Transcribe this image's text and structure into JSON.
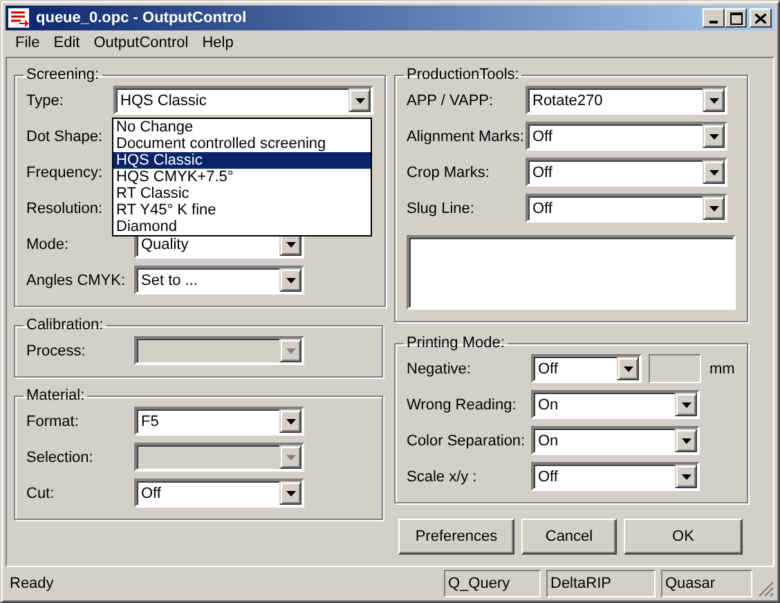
{
  "window": {
    "title": "queue_0.opc - OutputControl"
  },
  "menu": [
    "File",
    "Edit",
    "OutputControl",
    "Help"
  ],
  "screening": {
    "title": "Screening:",
    "fields": [
      {
        "label": "Type:",
        "kind": "wide-combo",
        "value": "HQS Classic",
        "disabled": false
      },
      {
        "label": "Dot Shape:",
        "kind": "label-only"
      },
      {
        "label": "Frequency:",
        "kind": "label-only"
      },
      {
        "label": "Resolution:",
        "kind": "label-only"
      },
      {
        "label": "Mode:",
        "kind": "combo",
        "value": "Quality",
        "disabled": false
      },
      {
        "label": "Angles CMYK:",
        "kind": "combo",
        "value": "Set to ...",
        "disabled": false
      }
    ],
    "open_list": [
      {
        "text": "No Change",
        "selected": false
      },
      {
        "text": "Document controlled screening",
        "selected": false
      },
      {
        "text": "HQS Classic",
        "selected": true
      },
      {
        "text": "HQS CMYK+7.5°",
        "selected": false
      },
      {
        "text": "RT Classic",
        "selected": false
      },
      {
        "text": "RT Y45° K fine",
        "selected": false
      },
      {
        "text": "Diamond",
        "selected": false
      }
    ]
  },
  "calibration": {
    "title": "Calibration:",
    "fields": [
      {
        "label": "Process:",
        "kind": "combo",
        "disabled": true
      }
    ]
  },
  "material": {
    "title": "Material:",
    "fields": [
      {
        "label": "Format:",
        "kind": "combo",
        "value": "F5",
        "disabled": false
      },
      {
        "label": "Selection:",
        "kind": "combo",
        "disabled": true
      },
      {
        "label": "Cut:",
        "kind": "combo",
        "value": "Off",
        "disabled": false
      }
    ]
  },
  "production_tools": {
    "title": "ProductionTools:",
    "fields": [
      {
        "label": "APP / VAPP:",
        "kind": "combo",
        "value": "Rotate270",
        "disabled": false
      },
      {
        "label": "Alignment Marks:",
        "kind": "combo",
        "value": "Off",
        "disabled": false
      },
      {
        "label": "Crop Marks:",
        "kind": "combo",
        "value": "Off",
        "disabled": false
      },
      {
        "label": "Slug Line:",
        "kind": "combo",
        "value": "Off",
        "disabled": false
      }
    ],
    "text_area": {
      "kind": "empty"
    }
  },
  "printing_mode": {
    "title": "Printing Mode:",
    "fields": [
      {
        "label": "Negative:",
        "kind": "short-combo",
        "value": "Off",
        "disabled": false,
        "unit": "mm"
      },
      {
        "label": "Wrong Reading:",
        "kind": "combo",
        "value": "On",
        "disabled": false
      },
      {
        "label": "Color Separation:",
        "kind": "combo",
        "value": "On",
        "disabled": false
      },
      {
        "label": "Scale x/y :",
        "kind": "combo",
        "value": "Off",
        "disabled": false
      }
    ]
  },
  "buttons": [
    "Preferences",
    "Cancel",
    "OK"
  ],
  "status_bar": {
    "message": "Ready",
    "panes": [
      "Q_Query",
      "DeltaRIP",
      "Quasar"
    ]
  }
}
